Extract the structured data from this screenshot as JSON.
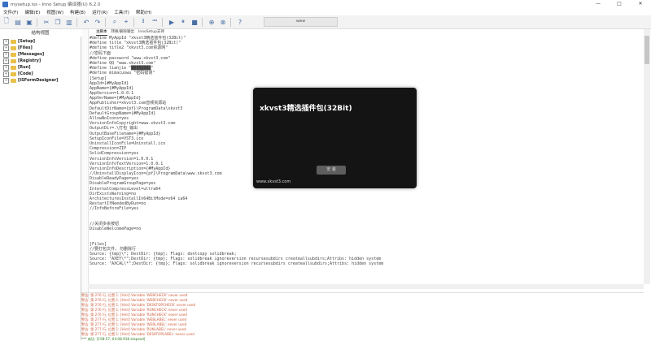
{
  "window": {
    "title": "mysetup.iss - Inno Setup 编译器(U) 6.2.0",
    "min_glyph": "—",
    "max_glyph": "□",
    "close_glyph": "✕"
  },
  "menu": [
    "文件(F)",
    "编辑(E)",
    "视图(W)",
    "构建(B)",
    "运行(R)",
    "工具(T)",
    "帮助(H)"
  ],
  "toolbar": {
    "search_value": "www"
  },
  "structure_panel": {
    "title": "结构视图",
    "items": [
      {
        "expander": "+",
        "label": "[Setup]"
      },
      {
        "expander": "+",
        "label": "[Files]"
      },
      {
        "expander": "+",
        "label": "[Messages]"
      },
      {
        "expander": "+",
        "label": "[Registry]"
      },
      {
        "expander": "+",
        "label": "[Run]"
      },
      {
        "expander": "+",
        "label": "[Code]"
      },
      {
        "expander": "+",
        "label": "[ISFormDesigner]"
      }
    ]
  },
  "editor_tabs": [
    "主脚本",
    "转换/删除输出",
    "InnoSetup支持"
  ],
  "code_lines": [
    "#define MyAppId \"xkvst3精选插件包(32Bit)\"",
    "#define title \"xkvst3精选插件包(32Bit)\"",
    "#define title2 \"xkvst3.com资源网\"",
    "//密码下面",
    "#define password \"www.xkvst3.com\"",
    "#define QQ \"www.xkvst3.com\"",
    "#define lianjie \"████████\"",
    "#define mimacuowu \"密码错误\"",
    "[Setup]",
    "AppId={#MyAppId}",
    "AppName={#MyAppId}",
    "AppVersion=1.0.0.1",
    "AppVerName={#MyAppId}",
    "AppPublisher=xkvst3.com音频资源站",
    "DefaultDirName={pf}\\ProgramData\\xkvst3",
    "DefaultGroupName={#MyAppId}",
    "AllowNoIcons=yes",
    "VersionInfoCopyright=www.xkvst3.com",
    "OutputDir=.\\打包_输出",
    "OutputBaseFilename={#MyAppId}",
    "SetupIconFile=VST3.ico",
    "UninstallIconFile=Uninstall.ico",
    "Compression=ZIP",
    "SolidCompression=yes",
    "VersionInfoVersion=1.0.0.1",
    "VersionInfoTextVersion=1.0.0.1",
    "VersionInfoDescription={#MyAppId}",
    "//UninstallDisplayIcon={pf}\\ProgramData\\www.xkvst3.com",
    "DisableReadyPage=yes",
    "DisableProgramGroupPage=yes",
    "InternalCompressLevel=ultra64",
    "DirExistsWarning=no",
    "ArchitecturesInstallIn64BitMode=x64 ia64",
    "RestartIfNeededByRun=no",
    "//InfoBeforeFile=yes",
    "",
    "",
    "//关闭多余按钮",
    "DisableWelcomePage=no",
    "",
    "",
    "[Files]",
    "//要打包文件, 勿删除行",
    "Source: {tmp}\\*; DestDir: {tmp}; Flags: dontcopy solidbreak;",
    "Source: \"AXEY\\*\";DestDir: {tmp}; Flags: solidbreak ignoreversion recursesubdirs createallsubdirs;Attribs: hidden system",
    "Source: \"AXCAL\\*\";DestDir: {tmp}; Flags: solidbreak ignoreversion recursesubdirs createallsubdirs;Attribs: hidden system"
  ],
  "splash": {
    "title": "xkvst3精选插件包(32Bit)",
    "button": "安 装",
    "url": "www.xkvst3.com"
  },
  "output_lines": [
    "警告: 第 276 行, 位置 1: [Hint] Variable 'WEBCHECK' never used",
    "警告: 第 276 行, 位置 1: [Hint] Variable 'WEBCHECK' never used",
    "警告: 第 276 行, 位置 1: [Hint] Variable 'DESKTOPCHECK' never used",
    "警告: 第 276 行, 位置 1: [Hint] Variable 'RUNCHECK' never used",
    "警告: 第 276 行, 位置 1: [Hint] Variable 'RUNCHECK' never used",
    "警告: 第 277 行, 位置 1: [Hint] Variable 'WEBLABEL' never used",
    "警告: 第 277 行, 位置 1: [Hint] Variable 'WEBLABEL' never used",
    "警告: 第 277 行, 位置 1: [Hint] Variable 'RUNLABEL' never used",
    "警告: 第 277 行, 位置 1: [Hint] Variable 'DESKTOPLABEL' never used",
    "*** 成功. [158:57, 04:08.918 elapsed]"
  ]
}
